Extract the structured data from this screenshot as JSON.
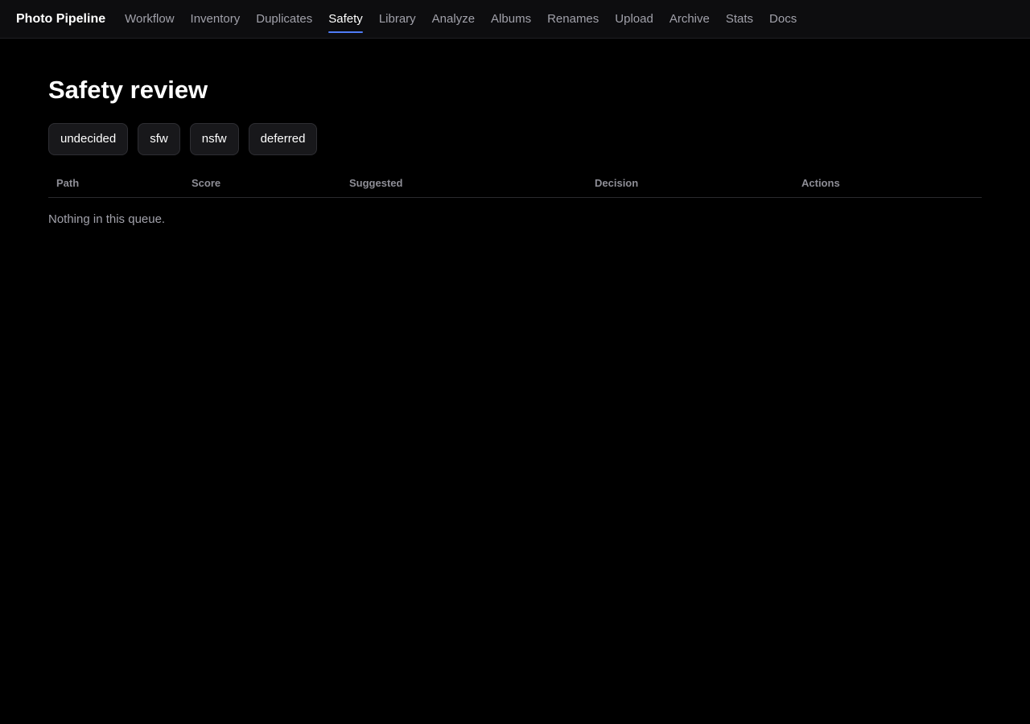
{
  "app": {
    "title": "Photo Pipeline"
  },
  "nav": {
    "items": [
      {
        "label": "Workflow"
      },
      {
        "label": "Inventory"
      },
      {
        "label": "Duplicates"
      },
      {
        "label": "Safety",
        "active": true
      },
      {
        "label": "Library"
      },
      {
        "label": "Analyze"
      },
      {
        "label": "Albums"
      },
      {
        "label": "Renames"
      },
      {
        "label": "Upload"
      },
      {
        "label": "Archive"
      },
      {
        "label": "Stats"
      },
      {
        "label": "Docs"
      }
    ],
    "active_color": "#4f7cf7"
  },
  "page": {
    "title": "Safety review"
  },
  "filters": [
    {
      "label": "undecided"
    },
    {
      "label": "sfw"
    },
    {
      "label": "nsfw"
    },
    {
      "label": "deferred"
    }
  ],
  "table": {
    "columns": [
      "Path",
      "Score",
      "Suggested",
      "Decision",
      "Actions"
    ],
    "rows": [],
    "empty_message": "Nothing in this queue."
  }
}
